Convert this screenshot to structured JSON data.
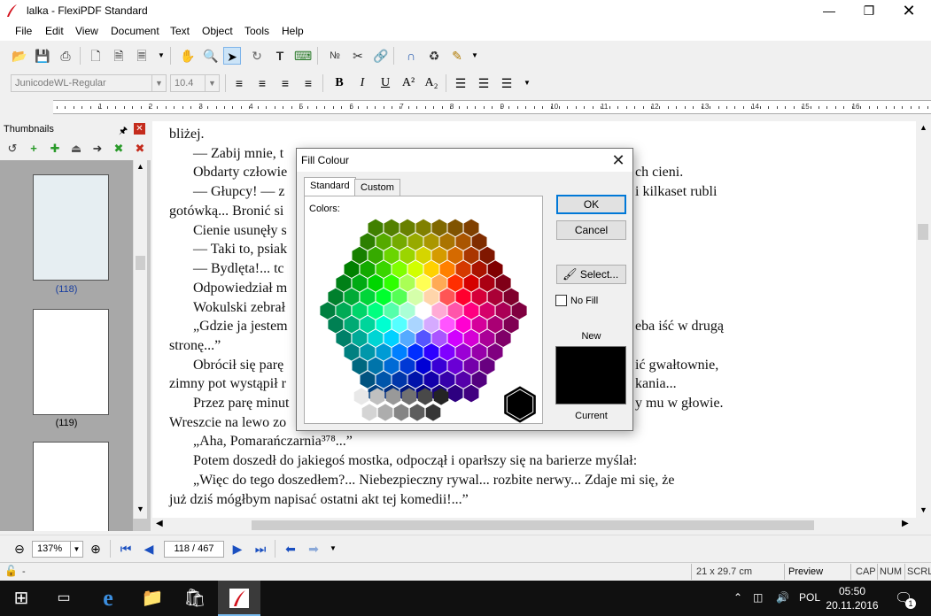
{
  "window": {
    "title": "lalka - FlexiPDF Standard"
  },
  "menu": [
    "File",
    "Edit",
    "View",
    "Document",
    "Text",
    "Object",
    "Tools",
    "Help"
  ],
  "format_toolbar": {
    "font_name": "JunicodeWL-Regular",
    "font_size": "10.4"
  },
  "ruler": {
    "numbers": [
      "1",
      "2",
      "3",
      "4",
      "5",
      "6",
      "7",
      "8",
      "9",
      "10",
      "11",
      "12",
      "13",
      "14",
      "15",
      "16"
    ]
  },
  "thumbnails": {
    "title": "Thumbnails",
    "pages": [
      {
        "label": "(118)"
      },
      {
        "label": "(119)"
      },
      {
        "label": ""
      }
    ]
  },
  "document": {
    "lines": [
      "bliżej.",
      "— Zabij mnie, t",
      "Obdarty człowie",
      "— Głupcy! — z",
      "gotówką... Bronić si",
      "Cienie usunęły s",
      "— Taki to, psiak",
      "— Bydlęta!... tc",
      "Odpowiedział m",
      "Wokulski zebrał",
      "„Gdzie ja jestem",
      "stronę...”",
      "Obrócił się parę",
      "zimny pot wystąpił r",
      "Przez parę minut",
      "Wreszcie na lewo zo",
      "„Aha, Pomarańczarnia³⁷⁸...”",
      "Potem doszedł do jakiegoś mostka, odpoczął i oparłszy się na barierze myślał:",
      "„Więc do tego doszedłem?... Niebezpieczny rywal... rozbite nerwy... Zdaje mi się, że",
      "już dziś mógłbym napisać ostatni akt tej komedii!...”"
    ],
    "right_fragments": [
      {
        "text": "ch cieni.",
        "line": 2
      },
      {
        "text": "i kilkaset rubli",
        "line": 3
      },
      {
        "text": "eba iść w drugą",
        "line": 10
      },
      {
        "text": "ić gwałtownie,",
        "line": 12
      },
      {
        "text": "kania...",
        "line": 13
      },
      {
        "text": "y mu w głowie.",
        "line": 14
      }
    ]
  },
  "navigation": {
    "zoom": "137%",
    "page": "118 / 467"
  },
  "status": {
    "page_size": "21 x 29.7 cm",
    "mode": "Preview",
    "caps": "CAP",
    "num": "NUM",
    "scroll": "SCRL"
  },
  "taskbar": {
    "language": "POL",
    "time": "05:50",
    "date": "20.11.2016",
    "notifications": "1"
  },
  "dialog": {
    "title": "Fill Colour",
    "tabs": [
      "Standard",
      "Custom"
    ],
    "colors_label": "Colors:",
    "ok": "OK",
    "cancel": "Cancel",
    "select": "Select...",
    "no_fill": "No Fill",
    "new_label": "New",
    "current_label": "Current",
    "new_color": "#000000"
  },
  "colors": {
    "accent": "#0078d7",
    "grays": [
      "#e8e8e8",
      "#d4d4d4",
      "#c0c0c0",
      "#adadad",
      "#999999",
      "#858585",
      "#717171",
      "#5d5d5d",
      "#494949",
      "#363636",
      "#242424"
    ]
  }
}
